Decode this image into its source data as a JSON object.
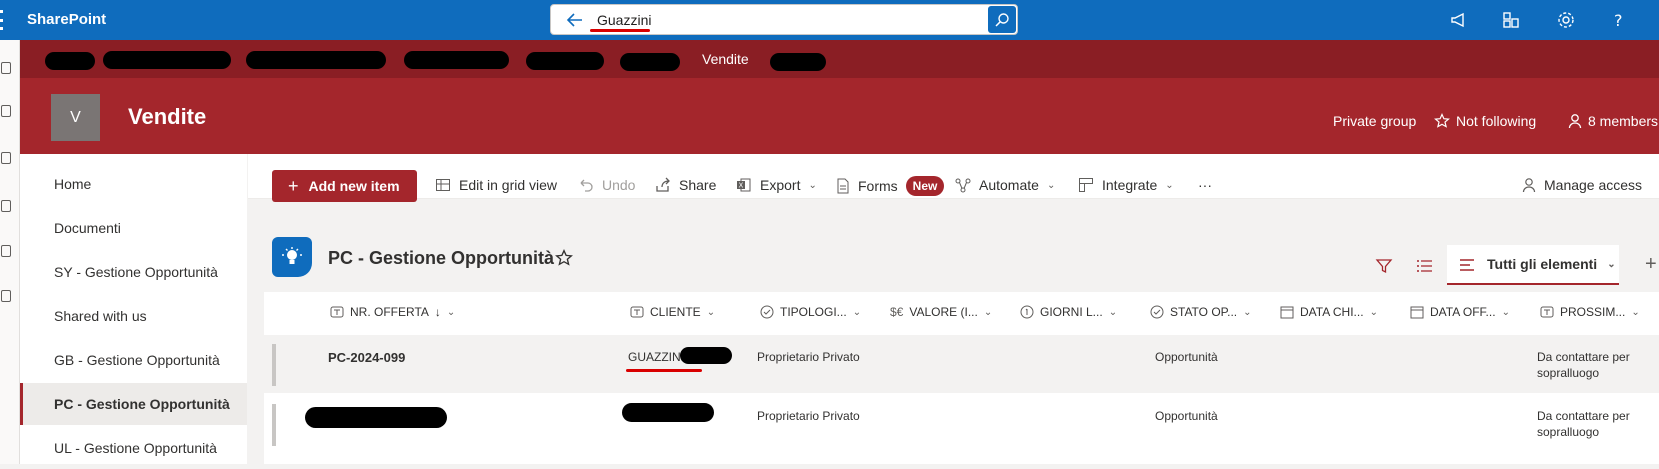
{
  "topbar": {
    "brand": "SharePoint",
    "search_value": "Guazzini"
  },
  "hub": {
    "visible_item": "Vendite"
  },
  "site": {
    "logo_letter": "V",
    "title": "Vendite",
    "privacy": "Private group",
    "follow": "Not following",
    "members": "8 members"
  },
  "nav": {
    "items": [
      {
        "label": "Home"
      },
      {
        "label": "Documenti"
      },
      {
        "label": "SY - Gestione Opportunità"
      },
      {
        "label": "Shared with us"
      },
      {
        "label": "GB - Gestione Opportunità"
      },
      {
        "label": "PC - Gestione Opportunità"
      },
      {
        "label": "UL - Gestione Opportunità"
      }
    ]
  },
  "cmdbar": {
    "add": "Add new item",
    "edit_grid": "Edit in grid view",
    "undo": "Undo",
    "share": "Share",
    "export": "Export",
    "forms": "Forms",
    "forms_badge": "New",
    "automate": "Automate",
    "integrate": "Integrate",
    "more": "···",
    "manage_access": "Manage access"
  },
  "list": {
    "title": "PC - Gestione Opportunità",
    "view": "Tutti gli elementi",
    "columns": [
      "NR. OFFERTA",
      "CLIENTE",
      "TIPOLOGI...",
      "VALORE (I...",
      "GIORNI L...",
      "STATO OP...",
      "DATA CHI...",
      "DATA OFF...",
      "PROSSIM..."
    ],
    "rows": [
      {
        "offerta": "PC-2024-099",
        "cliente": "GUAZZINI",
        "tipologia": "Proprietario Privato",
        "stato": "Opportunità",
        "prossimo": "Da contattare per sopralluogo"
      },
      {
        "offerta": "",
        "cliente": "",
        "tipologia": "Proprietario Privato",
        "stato": "Opportunità",
        "prossimo": "Da contattare per sopralluogo"
      }
    ]
  },
  "colors": {
    "suite_blue": "#0f6cbd",
    "hub_red": "#8a1e24",
    "site_red": "#a4262c",
    "annotation_red": "#d90000"
  }
}
